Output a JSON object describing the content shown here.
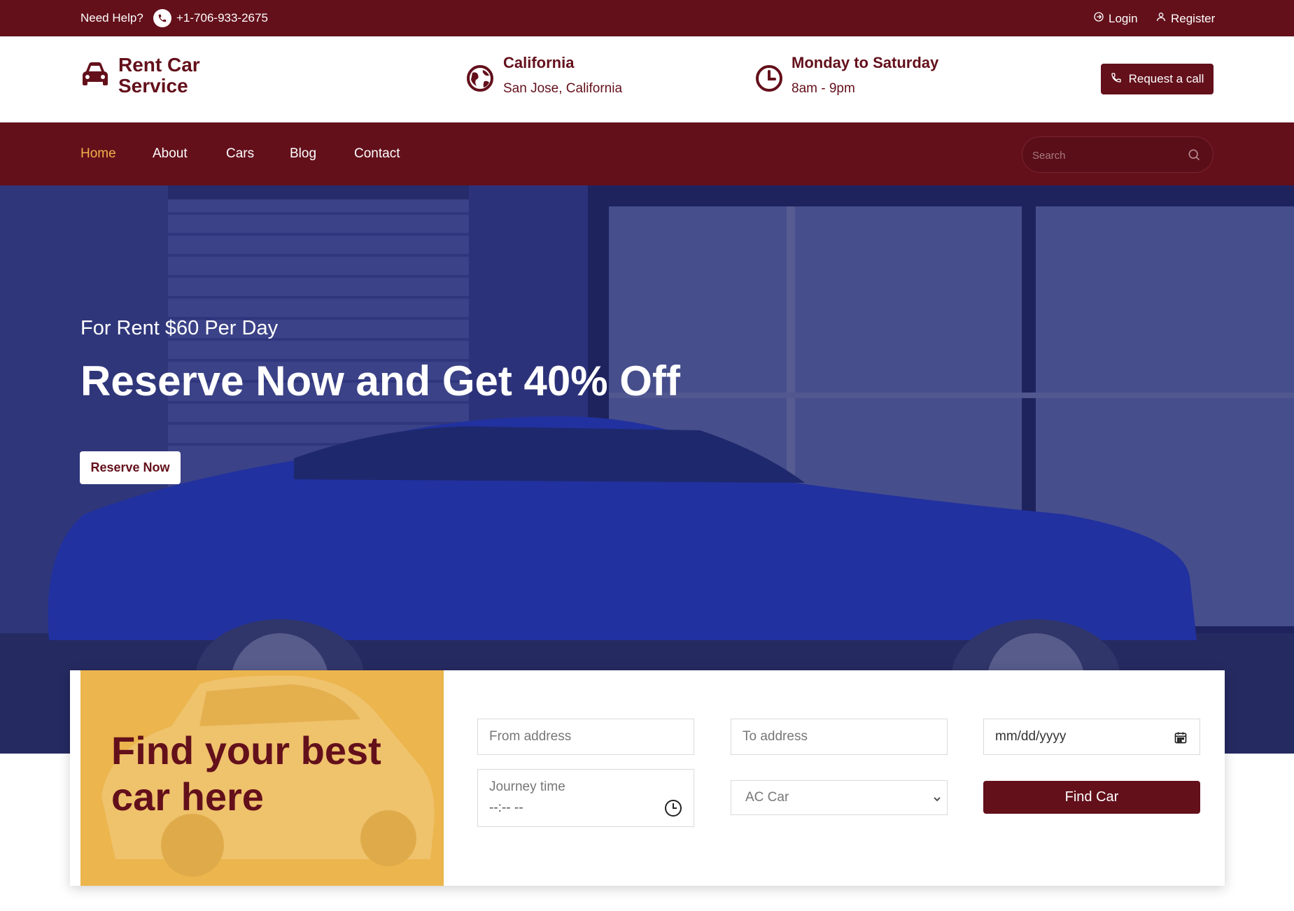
{
  "topbar": {
    "help_label": "Need Help?",
    "phone": "+1-706-933-2675",
    "login_label": "Login",
    "register_label": "Register"
  },
  "header": {
    "logo_text": "Rent Car Service",
    "location_title": "California",
    "location_sub": "San Jose, California",
    "hours_title": "Monday to Saturday",
    "hours_sub": "8am - 9pm",
    "request_call_label": "Request a call"
  },
  "nav": {
    "items": [
      {
        "label": "Home",
        "active": true
      },
      {
        "label": "About",
        "active": false
      },
      {
        "label": "Cars",
        "active": false
      },
      {
        "label": "Blog",
        "active": false
      },
      {
        "label": "Contact",
        "active": false
      }
    ],
    "search_placeholder": "Search"
  },
  "hero": {
    "kicker": "For Rent $60 Per Day",
    "title": "Reserve Now and Get 40% Off",
    "button_label": "Reserve Now"
  },
  "booking": {
    "title": "Find your best car here",
    "from_placeholder": "From address",
    "to_placeholder": "To address",
    "date_value": "mm/dd/yyyy",
    "journey_label": "Journey time",
    "journey_value": "--:-- --",
    "car_type_selected": "AC Car",
    "find_button_label": "Find Car"
  },
  "colors": {
    "brand": "#63101b",
    "accent": "#f0b04c",
    "card_panel": "#ecb54d"
  },
  "icons": {
    "phone": "phone-icon",
    "login": "login-icon",
    "register": "user-icon",
    "logo": "car-icon",
    "location": "globe-icon",
    "hours": "clock-icon",
    "search": "search-icon",
    "calendar": "calendar-icon",
    "chevron": "chevron-down-icon"
  }
}
